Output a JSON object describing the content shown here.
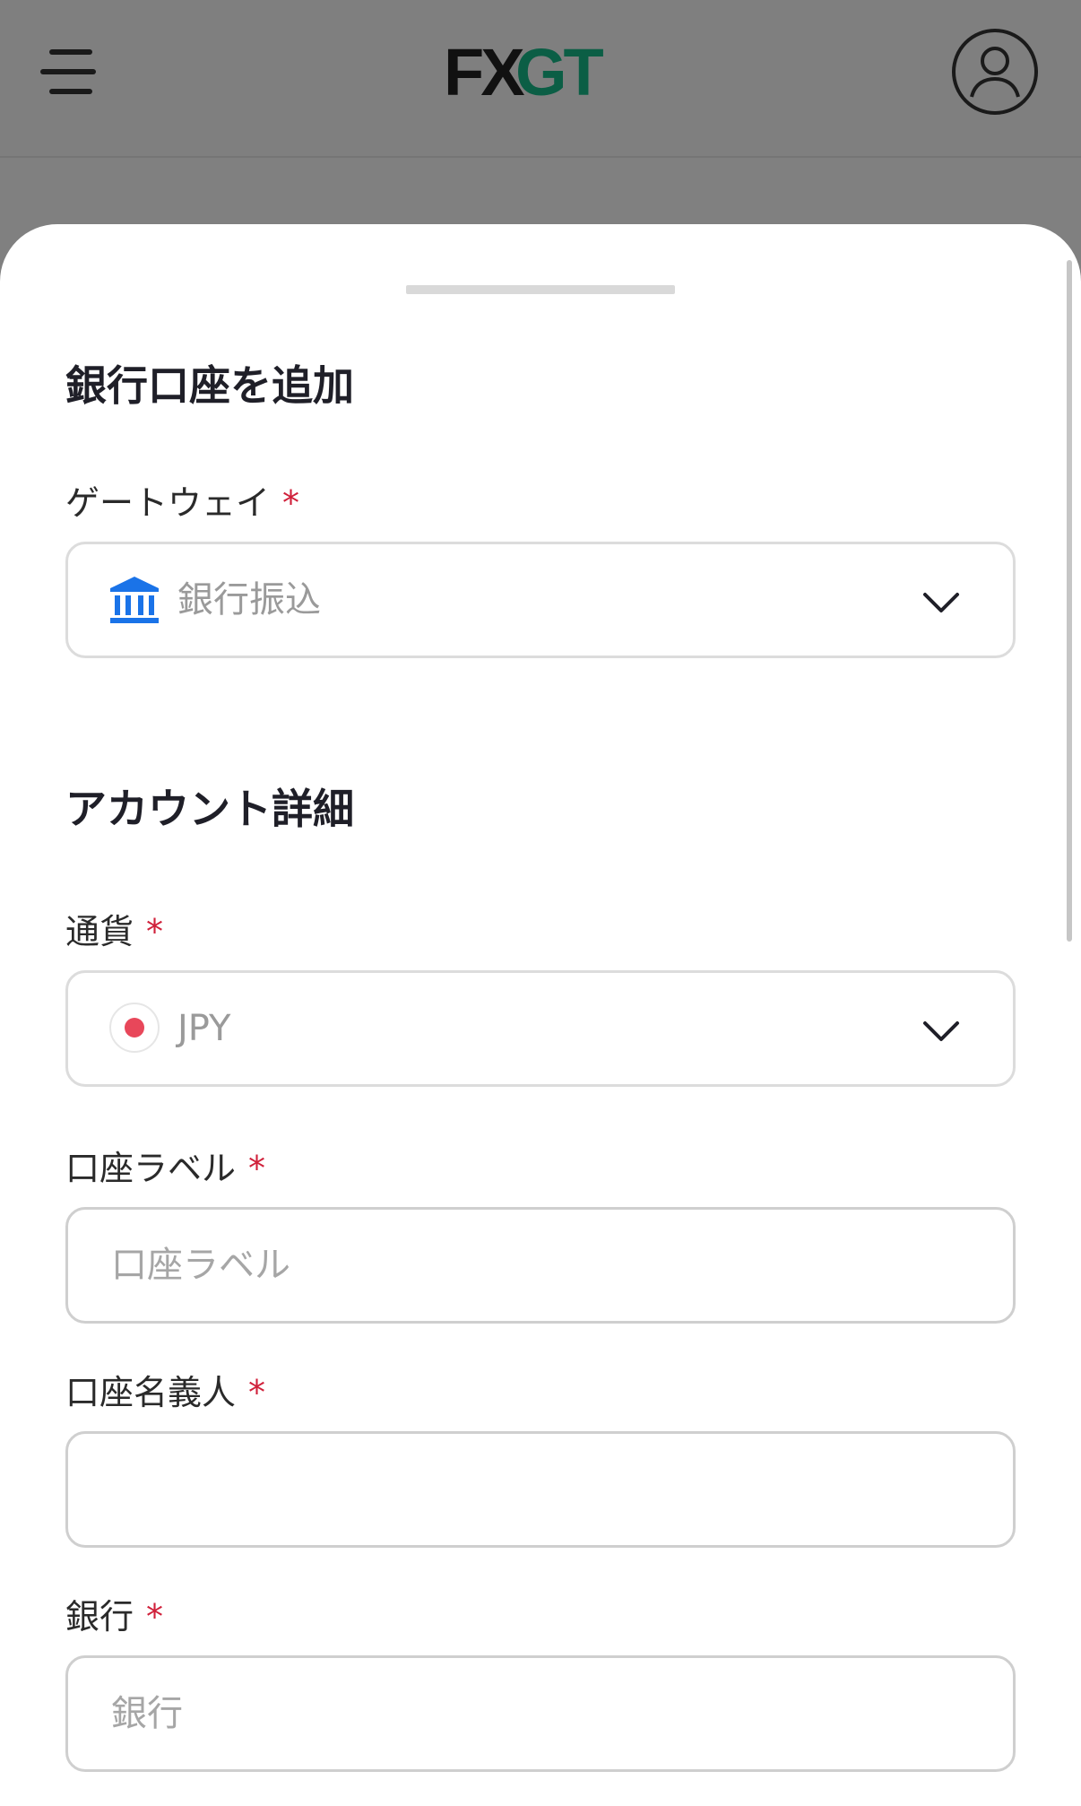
{
  "header": {
    "logo_left": "FX",
    "logo_right": "GT",
    "logo_colors": {
      "fx": "#111111",
      "gt": "#0b5e45"
    }
  },
  "sheet": {
    "title": "銀行口座を追加",
    "gateway": {
      "label": "ゲートウェイ",
      "required_mark": "*",
      "value": "銀行振込",
      "icon": "bank-icon",
      "icon_color": "#1a73e8"
    },
    "account_section_title": "アカウント詳細",
    "currency": {
      "label": "通貨",
      "required_mark": "*",
      "value": "JPY",
      "icon": "japan-flag-icon"
    },
    "account_label": {
      "label": "口座ラベル",
      "required_mark": "*",
      "placeholder": "口座ラベル",
      "value": ""
    },
    "account_holder": {
      "label": "口座名義人",
      "required_mark": "*",
      "placeholder": "",
      "value": ""
    },
    "bank": {
      "label": "銀行",
      "required_mark": "*",
      "placeholder": "銀行",
      "value": ""
    }
  },
  "colors": {
    "required": "#d0203a",
    "overlay": "#808080"
  }
}
